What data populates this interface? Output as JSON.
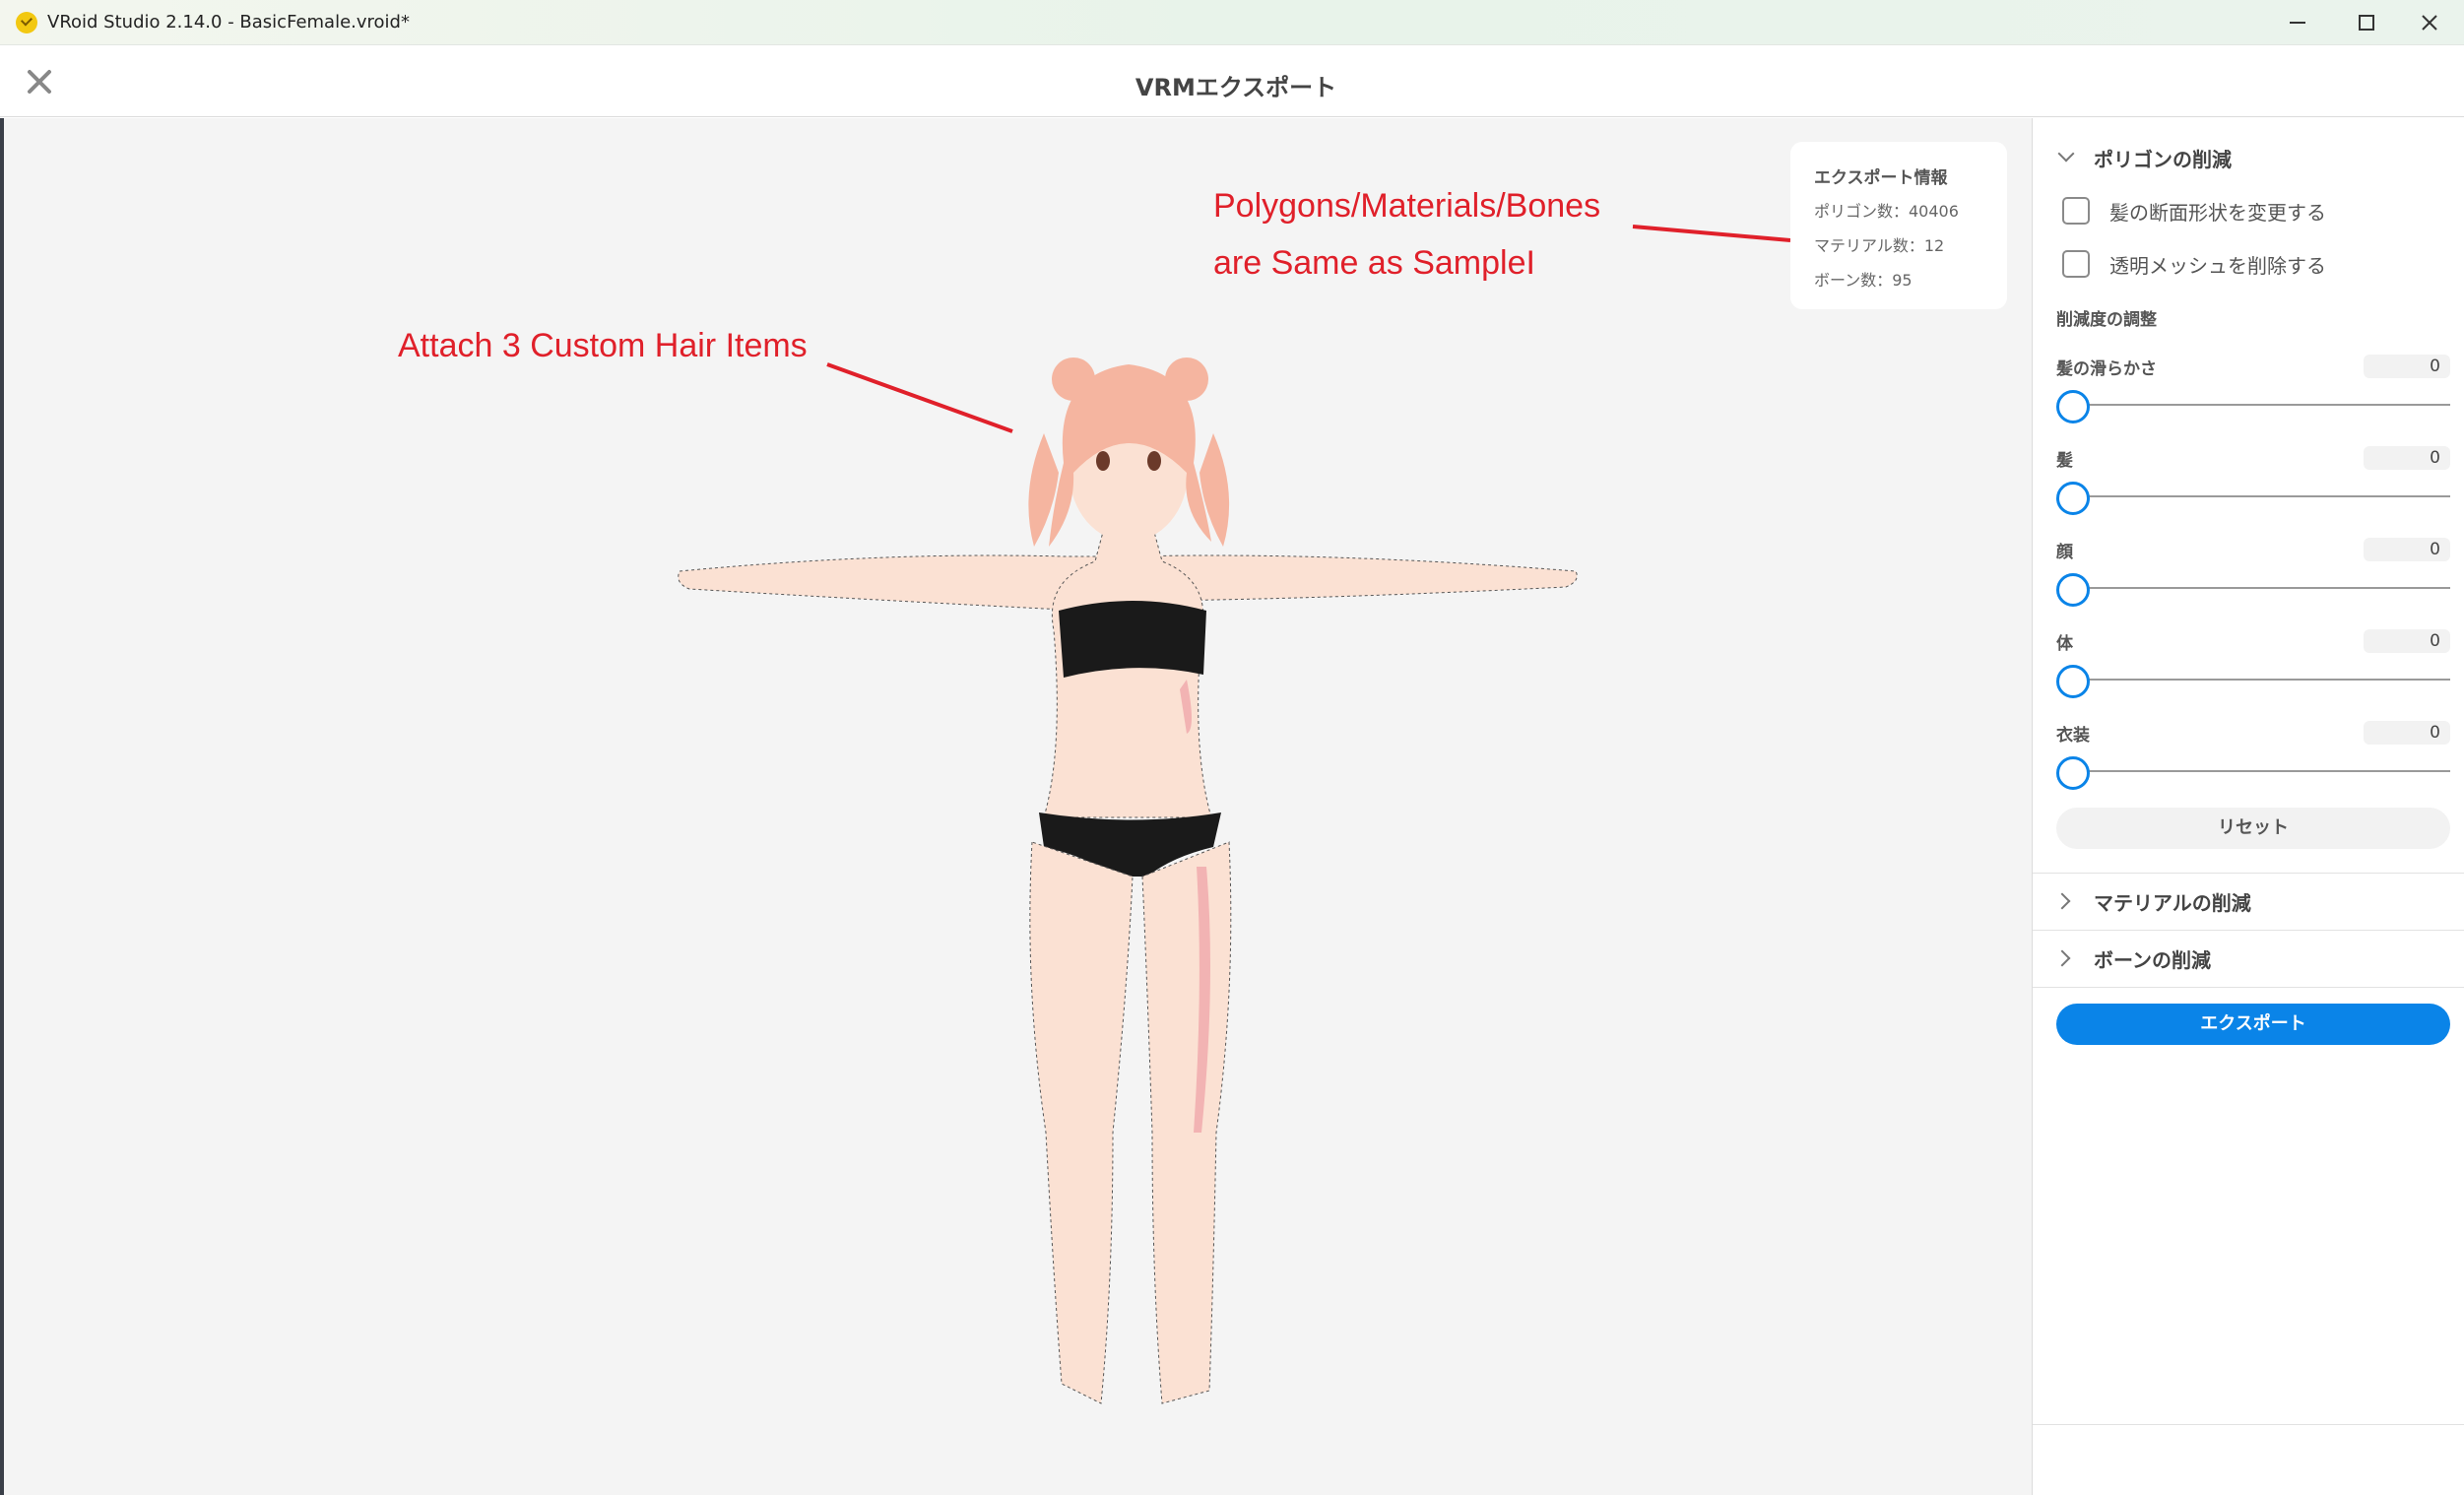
{
  "window": {
    "title": "VRoid Studio 2.14.0 - BasicFemale.vroid*"
  },
  "header": {
    "title": "VRMエクスポート"
  },
  "export_info": {
    "title": "エクスポート情報",
    "polygons": "ポリゴン数：40406",
    "materials": "マテリアル数：12",
    "bones": "ボーン数：95"
  },
  "annotations": {
    "hair": "Attach 3 Custom Hair Items",
    "poly_line1": "Polygons/Materials/Bones",
    "poly_line2": "are Same as SampleI"
  },
  "panel": {
    "polygon_section": "ポリゴンの削減",
    "check_hair_cross": "髪の断面形状を変更する",
    "check_transparent": "透明メッシュを削除する",
    "reduction_title": "削減度の調整",
    "sliders": [
      {
        "label": "髪の滑らかさ",
        "value": "0",
        "level": 0
      },
      {
        "label": "髪",
        "value": "0",
        "level": 0
      },
      {
        "label": "顔",
        "value": "0",
        "level": 0
      },
      {
        "label": "体",
        "value": "0",
        "level": 0
      },
      {
        "label": "衣装",
        "value": "0",
        "level": 0
      }
    ],
    "reset": "リセット",
    "material_section": "マテリアルの削減",
    "bone_section": "ボーンの削減",
    "export": "エクスポート"
  },
  "colors": {
    "accent": "#0a84e8",
    "annotation": "#e0202a"
  }
}
